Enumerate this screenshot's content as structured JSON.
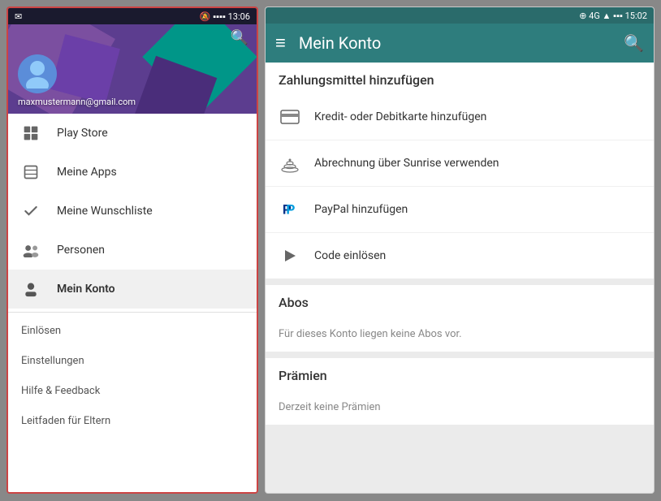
{
  "left_phone": {
    "status_bar": {
      "left_icons": "✉",
      "right_icons": "🔕  ▪▪▪▪  13:06"
    },
    "header": {
      "email": "maxmustermann@gmail.com"
    },
    "nav_items": [
      {
        "id": "play-store",
        "label": "Play Store",
        "icon": "store",
        "active": false
      },
      {
        "id": "meine-apps",
        "label": "Meine Apps",
        "icon": "apps",
        "active": false
      },
      {
        "id": "meine-wunschliste",
        "label": "Meine Wunschliste",
        "icon": "wishlist",
        "active": false
      },
      {
        "id": "personen",
        "label": "Personen",
        "icon": "people",
        "active": false
      },
      {
        "id": "mein-konto",
        "label": "Mein Konto",
        "icon": "account",
        "active": true
      }
    ],
    "footer_items": [
      {
        "id": "einloesen",
        "label": "Einlösen"
      },
      {
        "id": "einstellungen",
        "label": "Einstellungen"
      },
      {
        "id": "hilfe-feedback",
        "label": "Hilfe & Feedback"
      },
      {
        "id": "leitfaden",
        "label": "Leitfaden für Eltern"
      }
    ]
  },
  "right_phone": {
    "status_bar": {
      "right_icons": "⊕ 4G ▲ ▪▪▪  15:02"
    },
    "toolbar": {
      "menu_icon": "≡",
      "title": "Mein Konto",
      "search_icon": "search"
    },
    "payment_section": {
      "header": "Zahlungsmittel hinzufügen",
      "items": [
        {
          "id": "credit-card",
          "icon": "credit",
          "text": "Kredit- oder Debitkarte hinzufügen"
        },
        {
          "id": "sunrise",
          "icon": "signal",
          "text": "Abrechnung über Sunrise verwenden"
        },
        {
          "id": "paypal",
          "icon": "paypal",
          "text": "PayPal hinzufügen"
        },
        {
          "id": "code",
          "icon": "play",
          "text": "Code einlösen"
        }
      ]
    },
    "abos_section": {
      "header": "Abos",
      "content": "Für dieses Konto liegen keine Abos vor."
    },
    "praemien_section": {
      "header": "Prämien",
      "content": "Derzeit keine Prämien"
    }
  }
}
